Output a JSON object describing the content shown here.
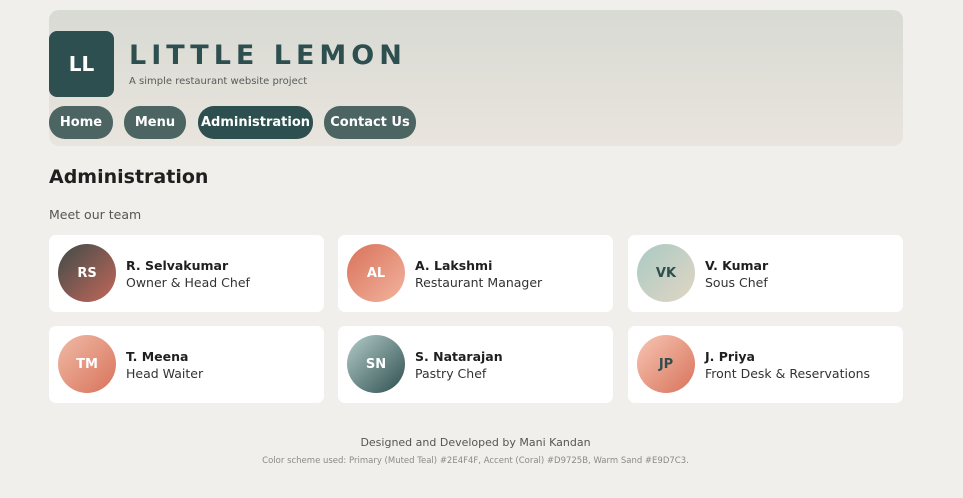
{
  "brand": {
    "logo_text": "LL",
    "title": "LITTLE LEMON",
    "subtitle": "A simple restaurant website project"
  },
  "nav": {
    "items": [
      {
        "label": "Home",
        "active": false
      },
      {
        "label": "Menu",
        "active": false
      },
      {
        "label": "Administration",
        "active": true
      },
      {
        "label": "Contact Us",
        "active": false
      }
    ]
  },
  "main": {
    "title": "Administration",
    "subtitle": "Meet our team"
  },
  "team": [
    {
      "initials": "RS",
      "name": "R. Selvakumar",
      "role": "Owner & Head Chef",
      "gradient": [
        "#3F4B48",
        "#C4675A"
      ],
      "initials_color": "#FFFFFF"
    },
    {
      "initials": "AL",
      "name": "A. Lakshmi",
      "role": "Restaurant Manager",
      "gradient": [
        "#D9725B",
        "#F2B49E"
      ],
      "initials_color": "#FFFFFF"
    },
    {
      "initials": "VK",
      "name": "V. Kumar",
      "role": "Sous Chef",
      "gradient": [
        "#A9CAC4",
        "#E2D6C3"
      ],
      "initials_color": "#2E4F4F"
    },
    {
      "initials": "TM",
      "name": "T. Meena",
      "role": "Head Waiter",
      "gradient": [
        "#F0BBA6",
        "#D9725B"
      ],
      "initials_color": "#FFFFFF"
    },
    {
      "initials": "SN",
      "name": "S. Natarajan",
      "role": "Pastry Chef",
      "gradient": [
        "#B3CCC9",
        "#2E4F4F"
      ],
      "initials_color": "#FFFFFF"
    },
    {
      "initials": "JP",
      "name": "J. Priya",
      "role": "Front Desk & Reservations",
      "gradient": [
        "#F6C6B3",
        "#D9725B"
      ],
      "initials_color": "#2E4F4F"
    }
  ],
  "footer": {
    "credit": "Designed and Developed by Mani Kandan",
    "colors": "Color scheme used: Primary (Muted Teal) #2E4F4F, Accent (Coral) #D9725B, Warm Sand #E9D7C3."
  },
  "colors": {
    "primary": "#2E4F4F",
    "accent": "#D9725B",
    "sand": "#E9D7C3",
    "background": "#F0EFEB"
  }
}
